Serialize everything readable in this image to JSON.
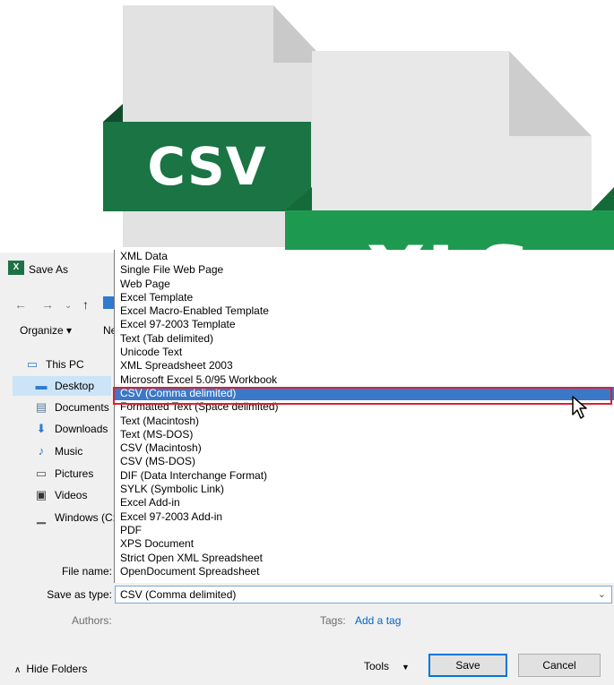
{
  "icons": {
    "csv": {
      "label": "CSV",
      "color": "#1a7443"
    },
    "xls": {
      "label": "XLS",
      "color": "#1e9a50"
    }
  },
  "dialog": {
    "title": "Save As",
    "app_logo": "X",
    "organize_label": "Organize ▾",
    "new_folder_partial": "Ne",
    "nav": {
      "this_pc": "This PC",
      "items": [
        {
          "label": "Desktop",
          "icon": "desktop-icon"
        },
        {
          "label": "Documents",
          "icon": "documents-icon"
        },
        {
          "label": "Downloads",
          "icon": "downloads-icon"
        },
        {
          "label": "Music",
          "icon": "music-icon"
        },
        {
          "label": "Pictures",
          "icon": "pictures-icon"
        },
        {
          "label": "Videos",
          "icon": "videos-icon"
        },
        {
          "label": "Windows (C:)",
          "icon": "drive-icon"
        }
      ]
    },
    "file_name_label": "File name:",
    "save_as_type_label": "Save as type:",
    "save_as_type_value": "CSV (Comma delimited)",
    "authors_label": "Authors:",
    "tags_label": "Tags:",
    "add_tag": "Add a tag",
    "hide_folders": "Hide Folders",
    "tools": "Tools",
    "save": "Save",
    "cancel": "Cancel",
    "selected_type_index": 10,
    "types": [
      "XML Data",
      "Single File Web Page",
      "Web Page",
      "Excel Template",
      "Excel Macro-Enabled Template",
      "Excel 97-2003 Template",
      "Text (Tab delimited)",
      "Unicode Text",
      "XML Spreadsheet 2003",
      "Microsoft Excel 5.0/95 Workbook",
      "CSV (Comma delimited)",
      "Formatted Text (Space delimited)",
      "Text (Macintosh)",
      "Text (MS-DOS)",
      "CSV (Macintosh)",
      "CSV (MS-DOS)",
      "DIF (Data Interchange Format)",
      "SYLK (Symbolic Link)",
      "Excel Add-in",
      "Excel 97-2003 Add-in",
      "PDF",
      "XPS Document",
      "Strict Open XML Spreadsheet",
      "OpenDocument Spreadsheet"
    ]
  }
}
